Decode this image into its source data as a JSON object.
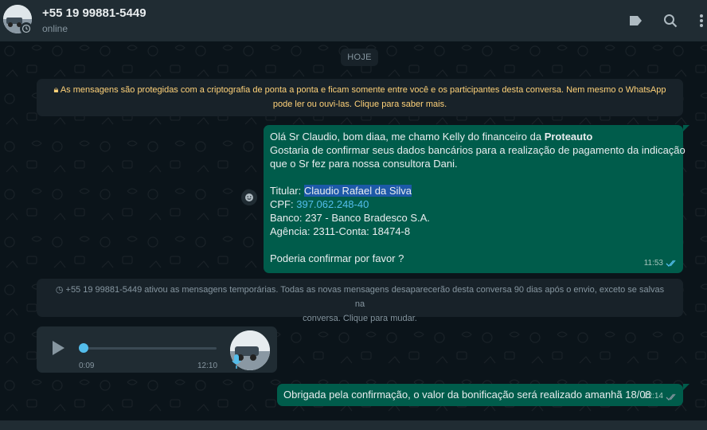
{
  "header": {
    "contact_name": "+55 19 99881-5449",
    "status": "online",
    "icons": [
      "label-icon",
      "search-icon",
      "menu-icon"
    ]
  },
  "chat": {
    "date_label": "HOJE",
    "encryption_notice": {
      "line1": "As mensagens são protegidas com a criptografia de ponta a ponta e ficam somente entre você e os participantes desta conversa. Nem mesmo o WhatsApp",
      "line2": "pode ler ou ouvi-las. Clique para saber mais."
    },
    "message1": {
      "intro": "Olá Sr Claudio, bom diaa, me chamo Kelly do financeiro da ",
      "company": "Proteauto",
      "line2": "Gostaria de confirmar seus dados bancários para a realização de pagamento da indicação",
      "line3": "que o Sr fez para nossa consultora Dani.",
      "titular_label": "Titular: ",
      "titular_value": "Claudio Rafael da Silva",
      "cpf_label": "CPF: ",
      "cpf_value": "397.062.248-40",
      "banco": "Banco: 237 - Banco Bradesco S.A.",
      "agencia": "Agência: 2311-Conta: 18474-8",
      "closing": "Poderia confirmar por favor ?",
      "time": "11:53"
    },
    "timer_notice": {
      "line1": "+55 19 99881-5449 ativou as mensagens temporárias. Todas as novas mensagens desaparecerão desta conversa 90 dias após o envio, exceto se salvas na",
      "line2": "conversa. Clique para mudar."
    },
    "audio_message": {
      "duration": "0:09",
      "time": "12:10",
      "progress": 0
    },
    "message2": {
      "text": "Obrigada pela confirmação, o valor da bonificação será realizado amanhã 18/08",
      "time": "12:14"
    }
  },
  "colors": {
    "outgoing_bubble": "#005c4b",
    "incoming_bubble": "#202c33",
    "header_bg": "#202c33",
    "chat_bg": "#0b141a",
    "encryption_text": "#ffd279",
    "link": "#53bdeb",
    "highlight": "#1d59a8"
  }
}
